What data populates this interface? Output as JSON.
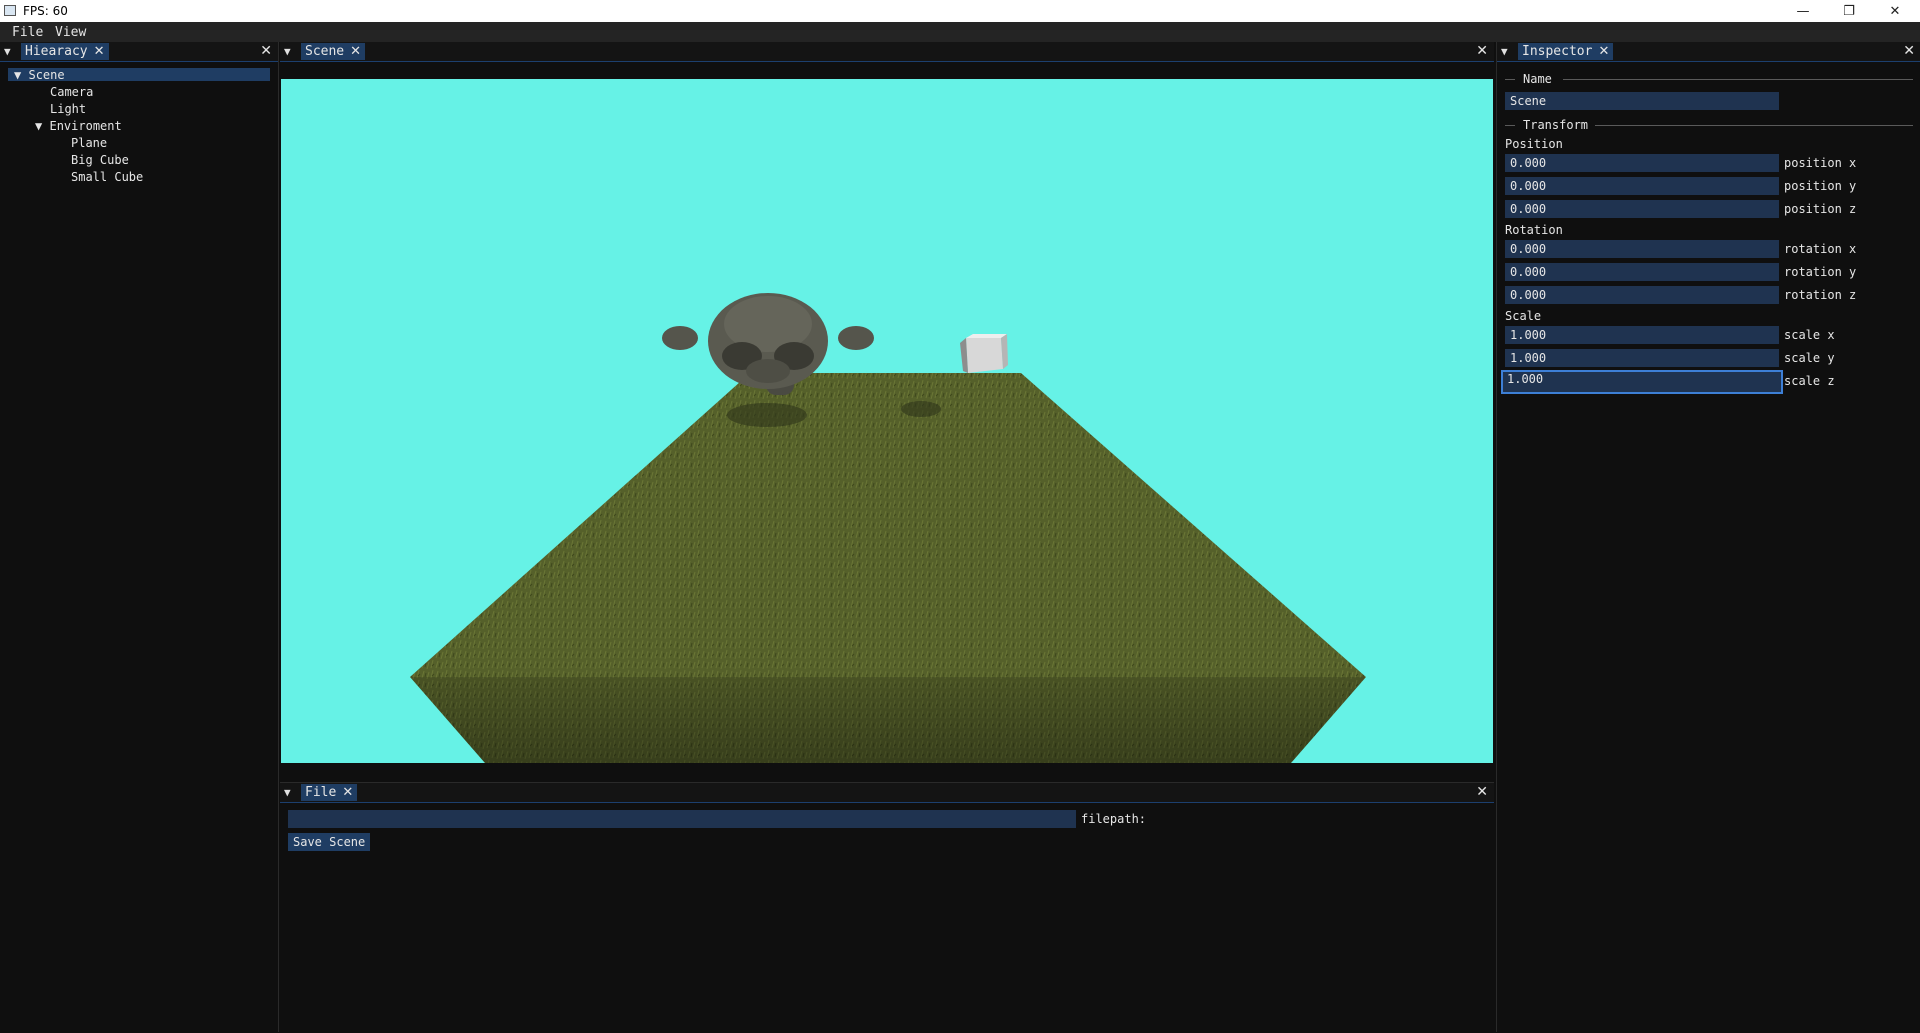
{
  "window": {
    "title": "FPS: 60",
    "buttons": {
      "minimize": "—",
      "restore": "❐",
      "close": "✕"
    }
  },
  "menu": [
    "File",
    "View"
  ],
  "hierarchy": {
    "tab_label": "Hiearacy",
    "items": [
      {
        "label": "Scene",
        "arrow": "▼"
      },
      {
        "label": "Camera",
        "arrow": ""
      },
      {
        "label": "Light",
        "arrow": ""
      },
      {
        "label": "Enviroment",
        "arrow": "▼"
      },
      {
        "label": "Plane",
        "arrow": ""
      },
      {
        "label": "Big Cube",
        "arrow": ""
      },
      {
        "label": "Small Cube",
        "arrow": ""
      }
    ]
  },
  "scene": {
    "tab_label": "Scene",
    "sky_color": "#66f2e6",
    "ground_color": "#4f5a22"
  },
  "inspector": {
    "tab_label": "Inspector",
    "name_header": "Name",
    "name_value": "Scene",
    "transform_header": "Transform",
    "position": {
      "label": "Position",
      "fields": [
        {
          "value": "0.000",
          "label": "position x"
        },
        {
          "value": "0.000",
          "label": "position y"
        },
        {
          "value": "0.000",
          "label": "position z"
        }
      ]
    },
    "rotation": {
      "label": "Rotation",
      "fields": [
        {
          "value": "0.000",
          "label": "rotation x"
        },
        {
          "value": "0.000",
          "label": "rotation y"
        },
        {
          "value": "0.000",
          "label": "rotation z"
        }
      ]
    },
    "scale": {
      "label": "Scale",
      "fields": [
        {
          "value": "1.000",
          "label": "scale x"
        },
        {
          "value": "1.000",
          "label": "scale y"
        },
        {
          "value": "1.000",
          "label": "scale z"
        }
      ]
    }
  },
  "file_panel": {
    "tab_label": "File",
    "filepath_value": "",
    "filepath_label": "filepath:",
    "save_label": "Save Scene"
  },
  "colors": {
    "accent": "#1f3d63",
    "active_border": "#3d7fd6",
    "panel_bg": "#0f0f0f"
  }
}
